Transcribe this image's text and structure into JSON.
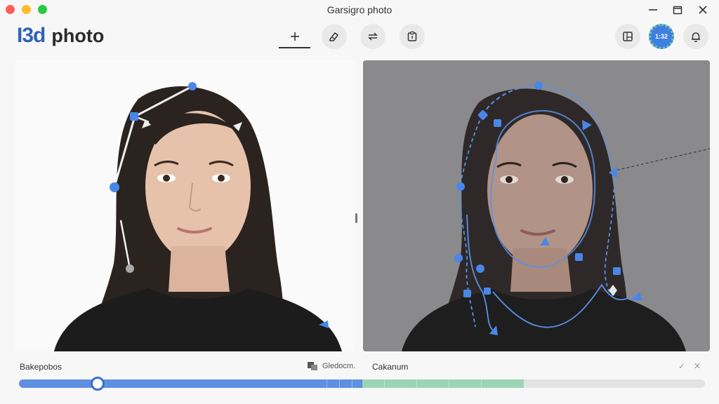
{
  "window": {
    "title": "Garsigro photo",
    "controls": [
      "minimize-icon",
      "restore-icon",
      "close-icon"
    ]
  },
  "app": {
    "logo_mark": "I3d",
    "logo_text": "photo"
  },
  "toolbar": {
    "tools": [
      "plus-icon",
      "eraser-icon",
      "swap-icon",
      "clipboard-icon"
    ],
    "active_tool": "plus-icon",
    "right": [
      "layout-icon",
      "avatar",
      "bell-icon"
    ]
  },
  "user": {
    "avatar_text": "1:32"
  },
  "bottom": {
    "left_label": "Bakepobos",
    "mid_label": "Gledocm.",
    "mid_label_2": "Cakanum",
    "right_icons": [
      "check-icon",
      "close-small-icon"
    ]
  },
  "timeline": {
    "progress_blue": 0.5,
    "progress_green_end": 0.735,
    "thumb_position": 0.115
  },
  "colors": {
    "accent": "#2f63b8",
    "point_blue": "#4a86e8",
    "track_blue": "#5f8fe2",
    "track_green": "#9dd4b4"
  }
}
